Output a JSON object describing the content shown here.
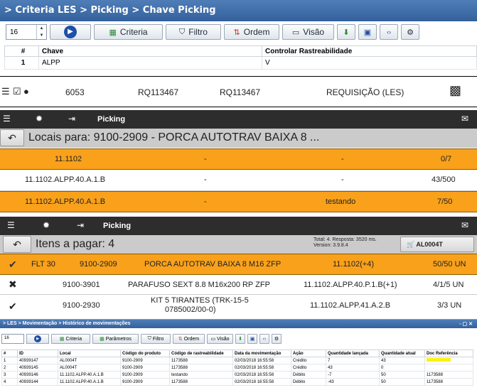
{
  "panel1": {
    "breadcrumb": "> Criteria LES > Picking > Chave Picking",
    "spinner_value": "16",
    "buttons": {
      "criteria": "Criteria",
      "filtro": "Filtro",
      "ordem": "Ordem",
      "visao": "Visão"
    },
    "table": {
      "headers": [
        "#",
        "Chave",
        "Controlar Rastreabilidade"
      ],
      "rows": [
        [
          "1",
          "ALPP",
          "V"
        ]
      ]
    }
  },
  "panel2": {
    "c1": "6053",
    "c2": "RQ113467",
    "c3": "RQ113467",
    "c4": "REQUISIÇÃO (LES)"
  },
  "panel3": {
    "bar_title": "Picking",
    "title": "Locais para: 9100-2909 - PORCA AUTOTRAV BAIXA 8 ...",
    "rows": [
      {
        "local": "11.1102",
        "a": "-",
        "b": "-",
        "qty": "0/7",
        "style": "orange"
      },
      {
        "local": "11.1102.ALPP.40.A.1.B",
        "a": "-",
        "b": "-",
        "qty": "43/500",
        "style": "white"
      },
      {
        "local": "11.1102.ALPP.40.A.1.B",
        "a": "-",
        "b": "testando",
        "qty": "7/50",
        "style": "orange"
      }
    ]
  },
  "panel4": {
    "bar_title": "Picking",
    "title": "Itens a pagar: 4",
    "info1": "Total: 4. Resposta: 3520 ms.",
    "info2": "Version: 3.9.8.4",
    "account": "AL0004T",
    "rows": [
      {
        "code1": "FLT 30",
        "code": "9100-2909",
        "desc": "PORCA AUTOTRAV BAIXA 8 M16 ZFP",
        "local": "11.1102(+4)",
        "qty": "50/50 UN"
      },
      {
        "code1": "",
        "code": "9100-3901",
        "desc": "PARAFUSO SEXT 8.8 M16x200 RP ZFP",
        "local": "11.1102.ALPP.40.P.1.B(+1)",
        "qty": "4/1/5 UN"
      },
      {
        "code1": "",
        "code": "9100-2930",
        "desc1": "KIT 5 TIRANTES (TRK-15-5",
        "desc2": "0785002/00-0)",
        "local": "11.1102.ALPP.41.A.2.B",
        "qty": "3/3 UN"
      }
    ]
  },
  "panel5": {
    "breadcrumb": "> LES > Movimentação > Histórico de movimentações",
    "spinner_value": "16",
    "buttons": {
      "criteria": "Criteria",
      "parametros": "Parâmetros",
      "filtro": "Filtro",
      "ordem": "Ordem",
      "visao": "Visão"
    },
    "headers": [
      "#",
      "ID",
      "Local",
      "Código do produto",
      "Código de rastreabilidade",
      "Data da movimentação",
      "Ação",
      "Quantidade lançada",
      "Quantidade atual",
      "Doc Referência"
    ],
    "rows": [
      [
        "1",
        "40939147",
        "AL0004T",
        "9100-2909",
        "1173588",
        "02/03/2018 16:55:58",
        "Crédito",
        "7",
        "43",
        ""
      ],
      [
        "2",
        "40939145",
        "AL0004T",
        "9100-2909",
        "1173588",
        "02/03/2018 16:55:58",
        "Crédito",
        "43",
        "0",
        ""
      ],
      [
        "3",
        "40939146",
        "11.1102.ALPP.40.A.1.B",
        "9100-2909",
        "testando",
        "02/03/2018 16:55:58",
        "Débito",
        "-7",
        "50",
        "1173588"
      ],
      [
        "4",
        "40939144",
        "11.1102.ALPP.40.A.1.B",
        "9100-2909",
        "1173588",
        "02/03/2018 16:55:58",
        "Débito",
        "-43",
        "50",
        "1173588"
      ]
    ]
  }
}
